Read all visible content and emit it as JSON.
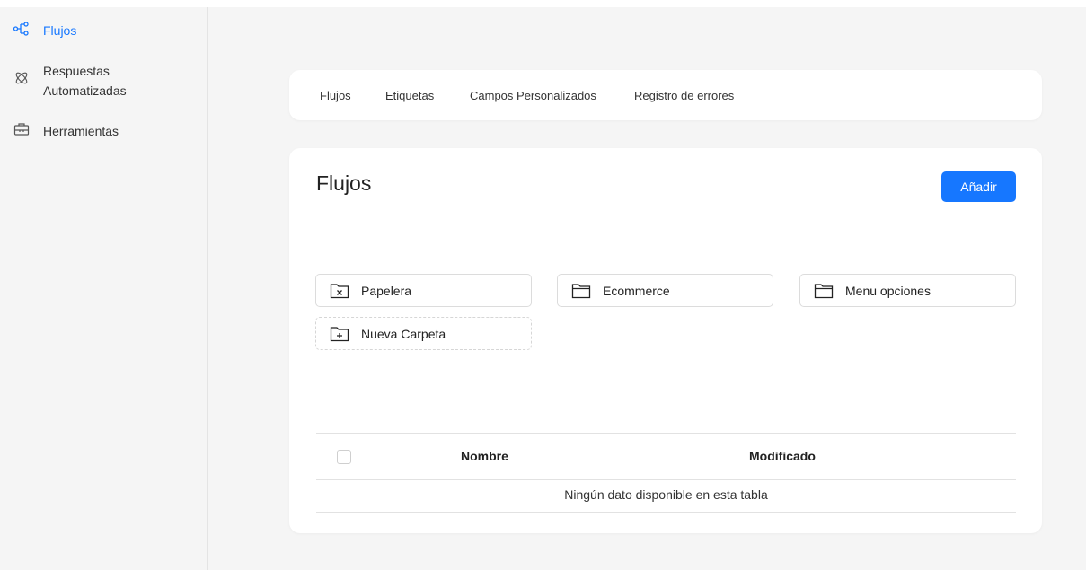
{
  "sidebar": {
    "items": [
      {
        "label": "Flujos",
        "icon": "flow-icon",
        "active": true
      },
      {
        "label": "Respuestas Automatizadas",
        "line1": "Respuestas",
        "line2": "Automatizadas",
        "icon": "atom-icon"
      },
      {
        "label": "Herramientas",
        "icon": "toolbox-icon"
      }
    ]
  },
  "tabs": [
    {
      "label": "Flujos"
    },
    {
      "label": "Etiquetas"
    },
    {
      "label": "Campos Personalizados"
    },
    {
      "label": "Registro de errores"
    }
  ],
  "main": {
    "title": "Flujos",
    "add_label": "Añadir",
    "folders": [
      {
        "label": "Papelera",
        "icon": "folder-x-icon"
      },
      {
        "label": "Ecommerce",
        "icon": "folder-icon"
      },
      {
        "label": "Menu opciones",
        "icon": "folder-icon"
      },
      {
        "label": "Nueva Carpeta",
        "icon": "folder-plus-icon"
      }
    ],
    "table": {
      "columns": [
        "Nombre",
        "Modificado"
      ],
      "empty_text": "Ningún dato disponible en esta tabla"
    }
  },
  "colors": {
    "accent": "#1677ff",
    "background": "#f5f5f5",
    "card": "#ffffff"
  }
}
